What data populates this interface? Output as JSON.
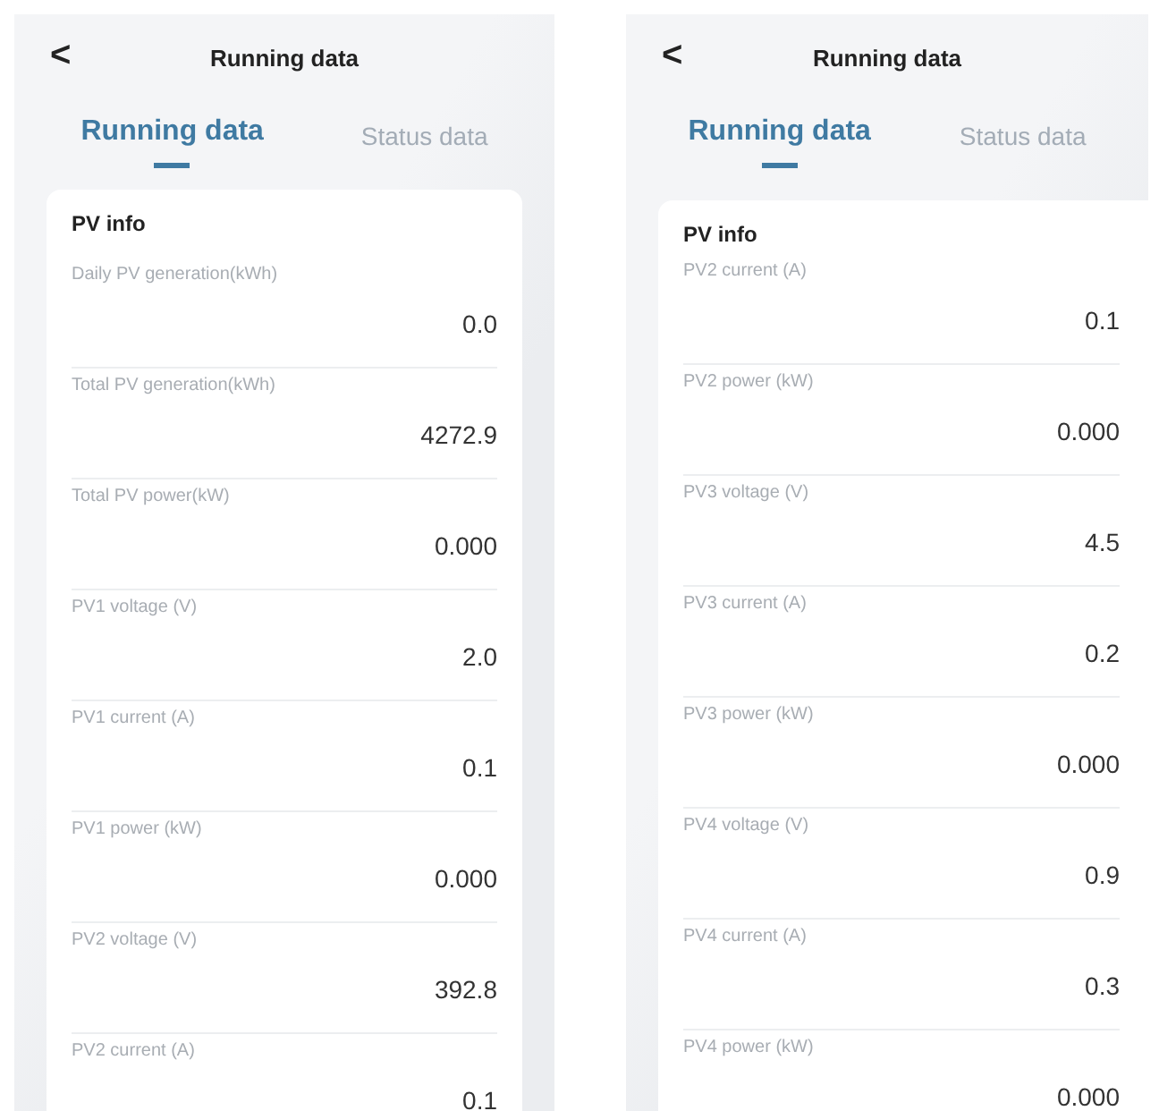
{
  "screens": [
    {
      "title": "Running data",
      "back": "<",
      "tabs": [
        {
          "label": "Running data",
          "selected": true
        },
        {
          "label": "Status data",
          "selected": false
        }
      ],
      "section_title": "PV info",
      "rows": [
        {
          "label": "Daily PV generation(kWh)",
          "value": "0.0"
        },
        {
          "label": "Total PV generation(kWh)",
          "value": "4272.9"
        },
        {
          "label": "Total PV power(kW)",
          "value": "0.000"
        },
        {
          "label": "PV1 voltage (V)",
          "value": "2.0"
        },
        {
          "label": "PV1 current (A)",
          "value": "0.1"
        },
        {
          "label": "PV1 power (kW)",
          "value": "0.000"
        },
        {
          "label": "PV2 voltage (V)",
          "value": "392.8"
        },
        {
          "label": "PV2 current (A)",
          "value": "0.1"
        }
      ]
    },
    {
      "title": "Running data",
      "back": "<",
      "tabs": [
        {
          "label": "Running data",
          "selected": true
        },
        {
          "label": "Status data",
          "selected": false
        }
      ],
      "section_title": "PV info",
      "rows": [
        {
          "label": "PV2 current (A)",
          "value": "0.1"
        },
        {
          "label": "PV2 power (kW)",
          "value": "0.000"
        },
        {
          "label": "PV3 voltage (V)",
          "value": "4.5"
        },
        {
          "label": "PV3 current (A)",
          "value": "0.2"
        },
        {
          "label": "PV3 power (kW)",
          "value": "0.000"
        },
        {
          "label": "PV4 voltage (V)",
          "value": "0.9"
        },
        {
          "label": "PV4 current (A)",
          "value": "0.3"
        },
        {
          "label": "PV4 power (kW)",
          "value": "0.000"
        }
      ]
    }
  ]
}
